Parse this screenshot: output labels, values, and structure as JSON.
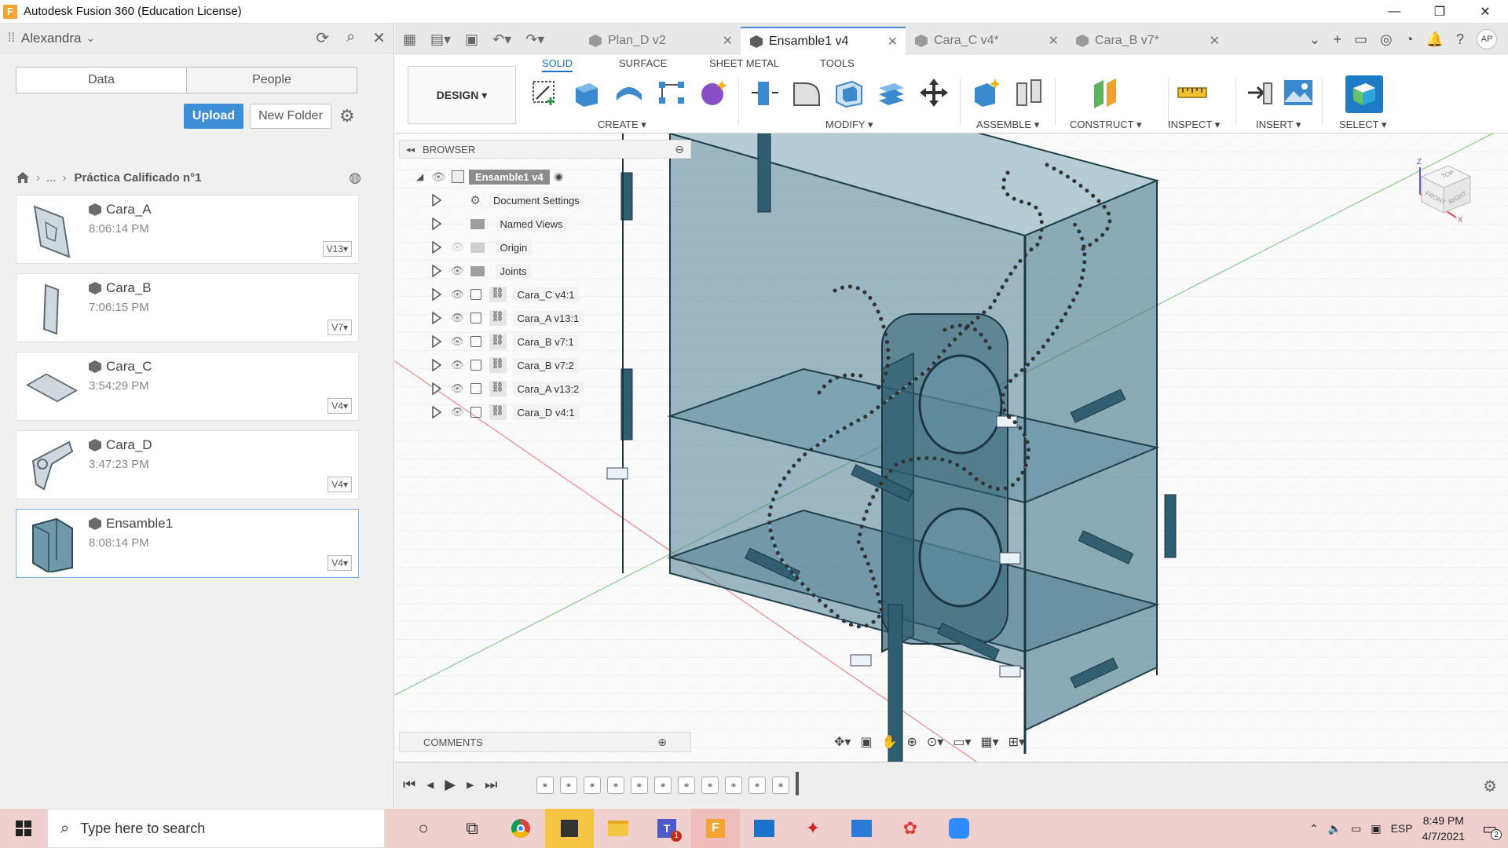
{
  "window": {
    "title": "Autodesk Fusion 360 (Education License)",
    "logo": "F"
  },
  "left_panel": {
    "user": "Alexandra",
    "tabs": [
      "Data",
      "People"
    ],
    "upload_label": "Upload",
    "new_folder_label": "New Folder",
    "breadcrumb": {
      "ellipsis": "...",
      "current": "Práctica Calificado n°1"
    },
    "files": [
      {
        "name": "Cara_A",
        "time": "8:06:14 PM",
        "version": "V13"
      },
      {
        "name": "Cara_B",
        "time": "7:06:15 PM",
        "version": "V7"
      },
      {
        "name": "Cara_C",
        "time": "3:54:29 PM",
        "version": "V4"
      },
      {
        "name": "Cara_D",
        "time": "3:47:23 PM",
        "version": "V4"
      },
      {
        "name": "Ensamble1",
        "time": "8:08:14 PM",
        "version": "V4"
      }
    ]
  },
  "doc_tabs": [
    "Plan_D v2",
    "Ensamble1 v4",
    "Cara_C v4*",
    "Cara_B v7*"
  ],
  "avatar": "AP",
  "ribbon": {
    "workspace": "DESIGN",
    "tabs": [
      "SOLID",
      "SURFACE",
      "SHEET METAL",
      "TOOLS"
    ],
    "groups": [
      "CREATE",
      "MODIFY",
      "ASSEMBLE",
      "CONSTRUCT",
      "INSPECT",
      "INSERT",
      "SELECT"
    ]
  },
  "browser": {
    "title": "BROWSER",
    "root": "Ensamble1 v4",
    "items": [
      "Document Settings",
      "Named Views",
      "Origin",
      "Joints",
      "Cara_C v4:1",
      "Cara_A v13:1",
      "Cara_B v7:1",
      "Cara_B v7:2",
      "Cara_A v13:2",
      "Cara_D v4:1"
    ]
  },
  "comments_label": "COMMENTS",
  "viewcube": {
    "top": "TOP",
    "front": "FRONT",
    "right": "RIGHT",
    "z": "Z",
    "x": "X"
  },
  "taskbar": {
    "search_placeholder": "Type here to search",
    "lang": "ESP",
    "time": "8:49 PM",
    "date": "4/7/2021",
    "notification_count": "2",
    "teams_badge": "1"
  },
  "colors": {
    "accent": "#3c8fd6",
    "model": "#2f6f87",
    "taskbar": "#f0cfcf"
  }
}
